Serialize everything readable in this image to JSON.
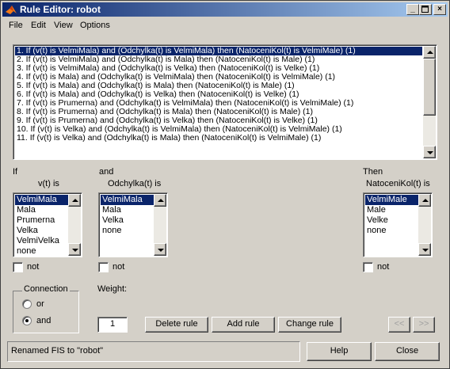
{
  "window": {
    "title": "Rule Editor: robot"
  },
  "menus": [
    "File",
    "Edit",
    "View",
    "Options"
  ],
  "rules": [
    "1. If (v(t) is VelmiMala) and (Odchylka(t) is VelmiMala) then (NatoceniKol(t) is VelmiMale) (1)",
    "2. If (v(t) is VelmiMala) and (Odchylka(t) is Mala) then (NatoceniKol(t) is Male) (1)",
    "3. If (v(t) is VelmiMala) and (Odchylka(t) is Velka) then (NatoceniKol(t) is Velke) (1)",
    "4. If (v(t) is Mala) and (Odchylka(t) is VelmiMala) then (NatoceniKol(t) is VelmiMale) (1)",
    "5. If (v(t) is Mala) and (Odchylka(t) is Mala) then (NatoceniKol(t) is Male) (1)",
    "6. If (v(t) is Mala) and (Odchylka(t) is Velka) then (NatoceniKol(t) is Velke) (1)",
    "7. If (v(t) is Prumerna) and (Odchylka(t) is VelmiMala) then (NatoceniKol(t) is VelmiMale) (1)",
    "8. If (v(t) is Prumerna) and (Odchylka(t) is Mala) then (NatoceniKol(t) is Male) (1)",
    "9. If (v(t) is Prumerna) and (Odchylka(t) is Velka) then (NatoceniKol(t) is Velke) (1)",
    "10. If (v(t) is Velka) and (Odchylka(t) is VelmiMala) then (NatoceniKol(t) is VelmiMale) (1)",
    "11. If (v(t) is Velka) and (Odchylka(t) is Mala) then (NatoceniKol(t) is VelmiMale) (1)"
  ],
  "selected_rule_index": 0,
  "labels": {
    "if": "If",
    "and": "and",
    "then": "Then",
    "var1": "v(t) is",
    "var2": "Odchylka(t) is",
    "var3": "NatoceniKol(t) is",
    "not": "not",
    "connection": "Connection",
    "or": "or",
    "and_option": "and",
    "weight": "Weight:"
  },
  "lists": {
    "v": [
      "VelmiMala",
      "Mala",
      "Prumerna",
      "Velka",
      "VelmiVelka",
      "none"
    ],
    "odchylka": [
      "VelmiMala",
      "Mala",
      "Velka",
      "none"
    ],
    "natoceni": [
      "VelmiMale",
      "Male",
      "Velke",
      "none"
    ]
  },
  "weight_value": "1",
  "connection_selected": "and",
  "buttons": {
    "delete": "Delete rule",
    "add": "Add rule",
    "change": "Change rule",
    "prev": "<<",
    "next": ">>",
    "help": "Help",
    "close": "Close"
  },
  "status": "Renamed FIS to \"robot\"",
  "colors": {
    "titlebar_start": "#0a246a",
    "titlebar_end": "#a6caf0",
    "selection": "#0a246a",
    "face": "#d4d0c8"
  },
  "icons": {
    "app": "matlab-icon",
    "minimize": "minimize-icon",
    "maximize": "maximize-icon",
    "close": "close-icon"
  }
}
